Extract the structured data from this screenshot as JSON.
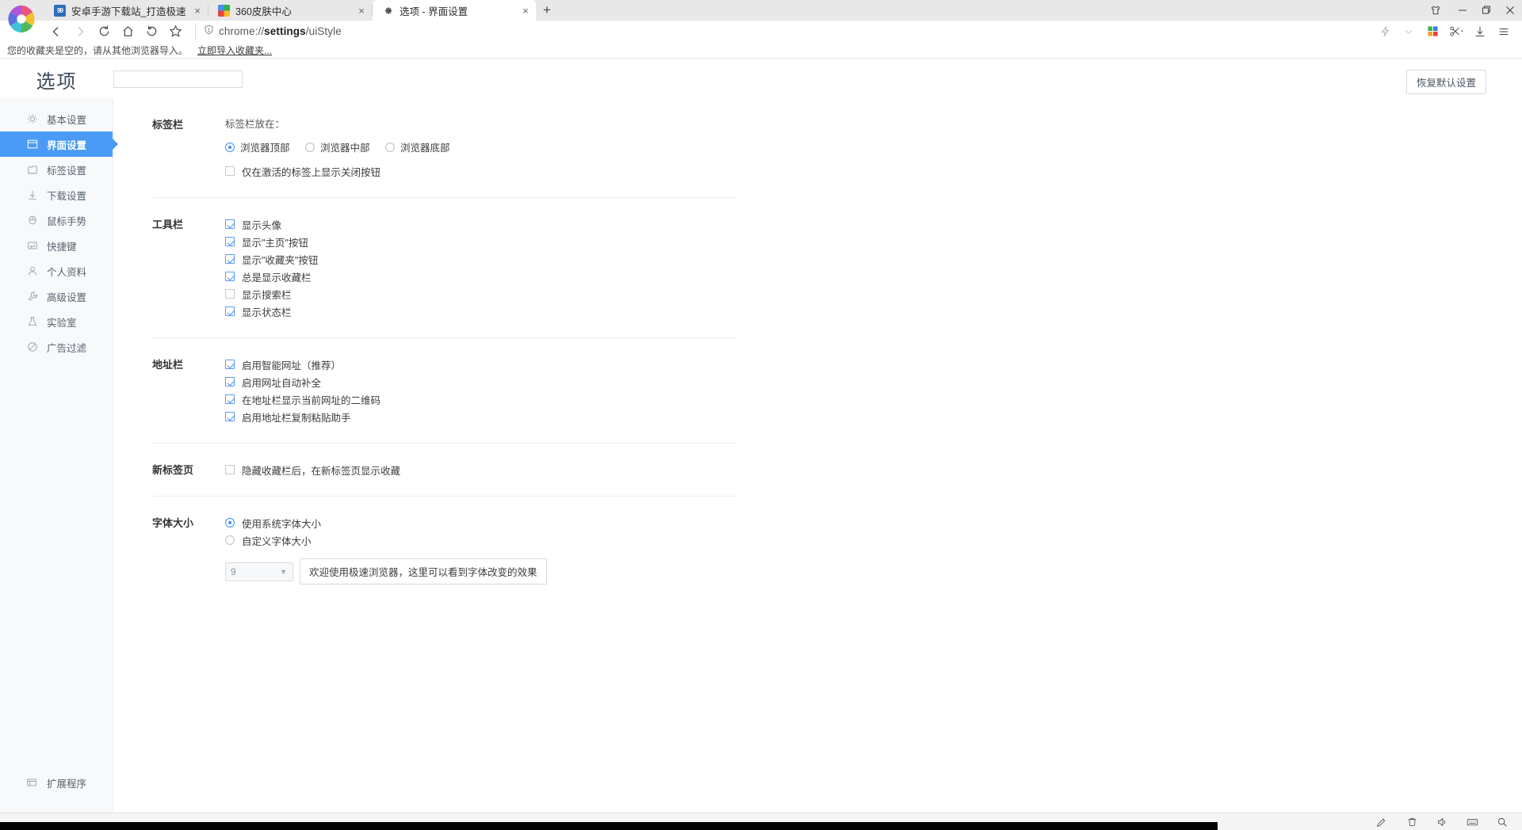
{
  "window": {
    "controls": [
      {
        "name": "skin-center-icon",
        "label": "皮肤"
      },
      {
        "name": "minimize-icon",
        "label": "最小化"
      },
      {
        "name": "maximize-icon",
        "label": "最大化"
      },
      {
        "name": "close-icon",
        "label": "关闭"
      }
    ]
  },
  "tabs": [
    {
      "title": "安卓手游下载站_打造极速手游下",
      "favicon": "game-site-icon",
      "active": false,
      "close_label": "×"
    },
    {
      "title": "360皮肤中心",
      "favicon": "360-skin-icon",
      "active": false,
      "close_label": "×"
    },
    {
      "title": "选项 - 界面设置",
      "favicon": "settings-gear-icon",
      "active": true,
      "close_label": "×"
    }
  ],
  "newtab_label": "+",
  "toolbar": {
    "back_label": "后退",
    "forward_label": "前进",
    "reload_label": "刷新",
    "home_label": "主页",
    "restore_label": "恢复",
    "bookmark_label": "收藏",
    "url_prefix": "chrome://",
    "url_bold": "settings",
    "url_suffix": "/uiStyle",
    "right_icons": [
      {
        "name": "lightning-icon"
      },
      {
        "name": "chevron-down-icon"
      },
      {
        "name": "apps-grid-icon"
      },
      {
        "name": "scissors-icon"
      },
      {
        "name": "download-icon"
      },
      {
        "name": "menu-icon"
      }
    ]
  },
  "bookmarkbar": {
    "message": "您的收藏夹是空的，请从其他浏览器导入。",
    "import_link": "立即导入收藏夹..."
  },
  "header": {
    "title": "选项",
    "search_value": "",
    "search_placeholder": "",
    "restore_defaults": "恢复默认设置"
  },
  "sidebar": {
    "items": [
      {
        "label": "基本设置",
        "icon": "sun-gear-icon",
        "active": false
      },
      {
        "label": "界面设置",
        "icon": "window-icon",
        "active": true
      },
      {
        "label": "标签设置",
        "icon": "tab-icon",
        "active": false
      },
      {
        "label": "下载设置",
        "icon": "download-arrow-icon",
        "active": false
      },
      {
        "label": "鼠标手势",
        "icon": "mouse-icon",
        "active": false
      },
      {
        "label": "快捷键",
        "icon": "keyboard-key-icon",
        "active": false
      },
      {
        "label": "个人资料",
        "icon": "person-icon",
        "active": false
      },
      {
        "label": "高级设置",
        "icon": "wrench-icon",
        "active": false
      },
      {
        "label": "实验室",
        "icon": "flask-icon",
        "active": false
      },
      {
        "label": "广告过滤",
        "icon": "circle-slash-icon",
        "active": false
      }
    ],
    "extensions": {
      "label": "扩展程序",
      "icon": "extensions-icon"
    }
  },
  "sections": [
    {
      "id": "tabbar",
      "label": "标签栏",
      "hint": "标签栏放在：",
      "radios": [
        {
          "label": "浏览器顶部",
          "checked": true
        },
        {
          "label": "浏览器中部",
          "checked": false
        },
        {
          "label": "浏览器底部",
          "checked": false
        }
      ],
      "checkboxes": [
        {
          "label": "仅在激活的标签上显示关闭按钮",
          "checked": false
        }
      ]
    },
    {
      "id": "toolbar",
      "label": "工具栏",
      "hint": "",
      "radios": [],
      "checkboxes": [
        {
          "label": "显示头像",
          "checked": true
        },
        {
          "label": "显示\"主页\"按钮",
          "checked": true
        },
        {
          "label": "显示\"收藏夹\"按钮",
          "checked": true
        },
        {
          "label": "总是显示收藏栏",
          "checked": true
        },
        {
          "label": "显示搜索栏",
          "checked": false
        },
        {
          "label": "显示状态栏",
          "checked": true
        }
      ]
    },
    {
      "id": "addressbar",
      "label": "地址栏",
      "hint": "",
      "radios": [],
      "checkboxes": [
        {
          "label": "启用智能网址（推荐）",
          "checked": true
        },
        {
          "label": "启用网址自动补全",
          "checked": true
        },
        {
          "label": "在地址栏显示当前网址的二维码",
          "checked": true
        },
        {
          "label": "启用地址栏复制粘贴助手",
          "checked": true
        }
      ]
    },
    {
      "id": "newtabpage",
      "label": "新标签页",
      "hint": "",
      "radios": [],
      "checkboxes": [
        {
          "label": "隐藏收藏栏后，在新标签页显示收藏",
          "checked": false
        }
      ]
    }
  ],
  "fontsection": {
    "label": "字体大小",
    "radios": [
      {
        "label": "使用系统字体大小",
        "checked": true
      },
      {
        "label": "自定义字体大小",
        "checked": false
      }
    ],
    "size_value": "9",
    "preview_text": "欢迎使用极速浏览器，这里可以看到字体改变的效果"
  },
  "taskbar": {
    "icons": [
      {
        "name": "pen-tablet-icon"
      },
      {
        "name": "trash-icon"
      },
      {
        "name": "volume-icon"
      },
      {
        "name": "keyboard-icon"
      },
      {
        "name": "search-icon"
      }
    ]
  },
  "colors": {
    "accent": "#4a9bf5",
    "sidebar_bg": "#f7f9fb",
    "checkbox_blue": "#3d8ff0"
  }
}
